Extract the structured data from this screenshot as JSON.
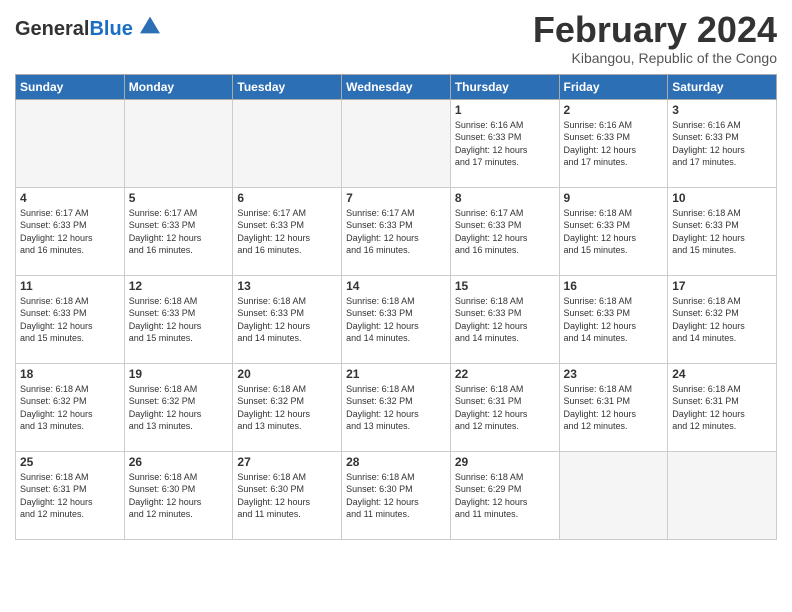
{
  "header": {
    "logo_general": "General",
    "logo_blue": "Blue",
    "month_title": "February 2024",
    "subtitle": "Kibangou, Republic of the Congo"
  },
  "calendar": {
    "days_of_week": [
      "Sunday",
      "Monday",
      "Tuesday",
      "Wednesday",
      "Thursday",
      "Friday",
      "Saturday"
    ],
    "weeks": [
      [
        {
          "day": "",
          "info": ""
        },
        {
          "day": "",
          "info": ""
        },
        {
          "day": "",
          "info": ""
        },
        {
          "day": "",
          "info": ""
        },
        {
          "day": "1",
          "info": "Sunrise: 6:16 AM\nSunset: 6:33 PM\nDaylight: 12 hours\nand 17 minutes."
        },
        {
          "day": "2",
          "info": "Sunrise: 6:16 AM\nSunset: 6:33 PM\nDaylight: 12 hours\nand 17 minutes."
        },
        {
          "day": "3",
          "info": "Sunrise: 6:16 AM\nSunset: 6:33 PM\nDaylight: 12 hours\nand 17 minutes."
        }
      ],
      [
        {
          "day": "4",
          "info": "Sunrise: 6:17 AM\nSunset: 6:33 PM\nDaylight: 12 hours\nand 16 minutes."
        },
        {
          "day": "5",
          "info": "Sunrise: 6:17 AM\nSunset: 6:33 PM\nDaylight: 12 hours\nand 16 minutes."
        },
        {
          "day": "6",
          "info": "Sunrise: 6:17 AM\nSunset: 6:33 PM\nDaylight: 12 hours\nand 16 minutes."
        },
        {
          "day": "7",
          "info": "Sunrise: 6:17 AM\nSunset: 6:33 PM\nDaylight: 12 hours\nand 16 minutes."
        },
        {
          "day": "8",
          "info": "Sunrise: 6:17 AM\nSunset: 6:33 PM\nDaylight: 12 hours\nand 16 minutes."
        },
        {
          "day": "9",
          "info": "Sunrise: 6:18 AM\nSunset: 6:33 PM\nDaylight: 12 hours\nand 15 minutes."
        },
        {
          "day": "10",
          "info": "Sunrise: 6:18 AM\nSunset: 6:33 PM\nDaylight: 12 hours\nand 15 minutes."
        }
      ],
      [
        {
          "day": "11",
          "info": "Sunrise: 6:18 AM\nSunset: 6:33 PM\nDaylight: 12 hours\nand 15 minutes."
        },
        {
          "day": "12",
          "info": "Sunrise: 6:18 AM\nSunset: 6:33 PM\nDaylight: 12 hours\nand 15 minutes."
        },
        {
          "day": "13",
          "info": "Sunrise: 6:18 AM\nSunset: 6:33 PM\nDaylight: 12 hours\nand 14 minutes."
        },
        {
          "day": "14",
          "info": "Sunrise: 6:18 AM\nSunset: 6:33 PM\nDaylight: 12 hours\nand 14 minutes."
        },
        {
          "day": "15",
          "info": "Sunrise: 6:18 AM\nSunset: 6:33 PM\nDaylight: 12 hours\nand 14 minutes."
        },
        {
          "day": "16",
          "info": "Sunrise: 6:18 AM\nSunset: 6:33 PM\nDaylight: 12 hours\nand 14 minutes."
        },
        {
          "day": "17",
          "info": "Sunrise: 6:18 AM\nSunset: 6:32 PM\nDaylight: 12 hours\nand 14 minutes."
        }
      ],
      [
        {
          "day": "18",
          "info": "Sunrise: 6:18 AM\nSunset: 6:32 PM\nDaylight: 12 hours\nand 13 minutes."
        },
        {
          "day": "19",
          "info": "Sunrise: 6:18 AM\nSunset: 6:32 PM\nDaylight: 12 hours\nand 13 minutes."
        },
        {
          "day": "20",
          "info": "Sunrise: 6:18 AM\nSunset: 6:32 PM\nDaylight: 12 hours\nand 13 minutes."
        },
        {
          "day": "21",
          "info": "Sunrise: 6:18 AM\nSunset: 6:32 PM\nDaylight: 12 hours\nand 13 minutes."
        },
        {
          "day": "22",
          "info": "Sunrise: 6:18 AM\nSunset: 6:31 PM\nDaylight: 12 hours\nand 12 minutes."
        },
        {
          "day": "23",
          "info": "Sunrise: 6:18 AM\nSunset: 6:31 PM\nDaylight: 12 hours\nand 12 minutes."
        },
        {
          "day": "24",
          "info": "Sunrise: 6:18 AM\nSunset: 6:31 PM\nDaylight: 12 hours\nand 12 minutes."
        }
      ],
      [
        {
          "day": "25",
          "info": "Sunrise: 6:18 AM\nSunset: 6:31 PM\nDaylight: 12 hours\nand 12 minutes."
        },
        {
          "day": "26",
          "info": "Sunrise: 6:18 AM\nSunset: 6:30 PM\nDaylight: 12 hours\nand 12 minutes."
        },
        {
          "day": "27",
          "info": "Sunrise: 6:18 AM\nSunset: 6:30 PM\nDaylight: 12 hours\nand 11 minutes."
        },
        {
          "day": "28",
          "info": "Sunrise: 6:18 AM\nSunset: 6:30 PM\nDaylight: 12 hours\nand 11 minutes."
        },
        {
          "day": "29",
          "info": "Sunrise: 6:18 AM\nSunset: 6:29 PM\nDaylight: 12 hours\nand 11 minutes."
        },
        {
          "day": "",
          "info": ""
        },
        {
          "day": "",
          "info": ""
        }
      ]
    ]
  }
}
